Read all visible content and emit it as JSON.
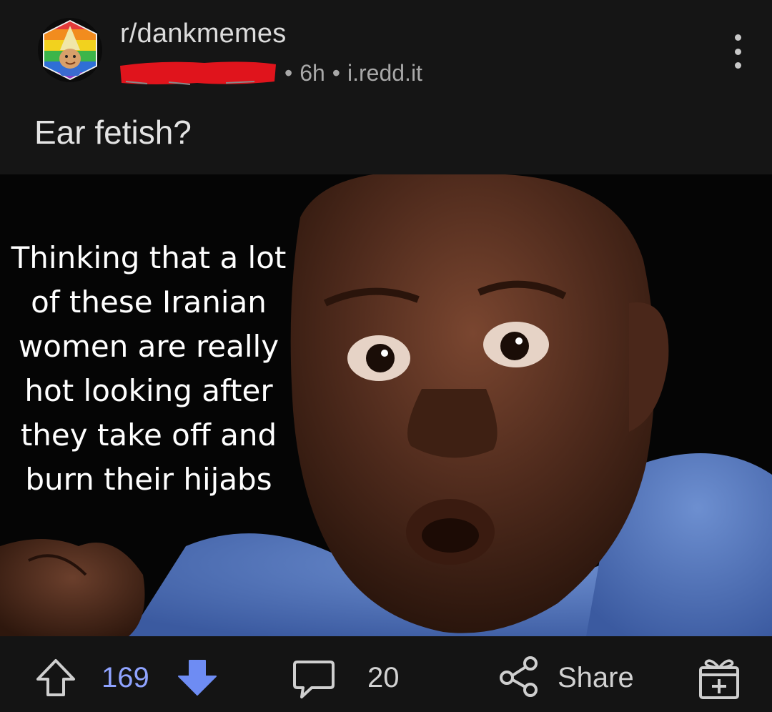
{
  "header": {
    "subreddit": "r/dankmemes",
    "age": "6h",
    "domain": "i.redd.it",
    "separator": "•"
  },
  "post": {
    "title": "Ear fetish?"
  },
  "meme": {
    "text_lines": [
      "Thinking that a lot",
      "of these Iranian",
      "women are really",
      "hot looking after",
      "they take off and",
      "burn their hijabs"
    ]
  },
  "actions": {
    "score": "169",
    "comments": "20",
    "share_label": "Share"
  },
  "icons": {
    "upvote": "arrow-up-outline-icon",
    "downvote": "arrow-down-filled-icon",
    "comment": "speech-bubble-icon",
    "share": "share-nodes-icon",
    "award": "gift-plus-icon",
    "more": "vertical-ellipsis-icon"
  },
  "colors": {
    "background": "#151515",
    "score": "#8fa3ff",
    "downvote_active": "#6e8cf3",
    "redaction": "#e0141c"
  }
}
